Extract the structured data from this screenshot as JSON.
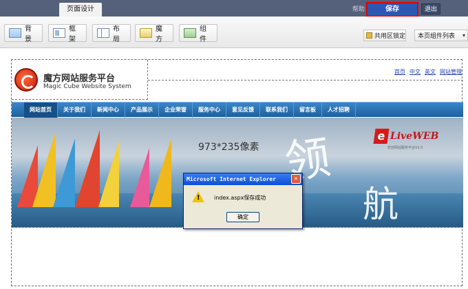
{
  "topbar": {
    "tab": "页面设计",
    "help": "帮助",
    "save": "保存",
    "logout": "退出"
  },
  "toolbar": {
    "buttons": [
      {
        "label": "背景",
        "icon": "background-icon"
      },
      {
        "label": "框架",
        "icon": "frame-icon"
      },
      {
        "label": "布局",
        "icon": "layout-icon"
      },
      {
        "label": "魔方",
        "icon": "magic-cube-icon"
      },
      {
        "label": "组件",
        "icon": "component-icon"
      }
    ],
    "lock_area": "共用区锁定",
    "component_list": "本页组件列表"
  },
  "site": {
    "logo_cn": "魔方网站服务平台",
    "logo_en": "Magic Cube Website System",
    "top_links": [
      "首页",
      "中文",
      "英文",
      "网站管理"
    ],
    "nav": [
      "网站首页",
      "关于我们",
      "新闻中心",
      "产品展示",
      "企业荣誉",
      "服务中心",
      "意见反馈",
      "联系我们",
      "留言板",
      "人才招聘"
    ],
    "banner_size": "973*235像素",
    "brand": "LiveWEB",
    "brand_sub": "宏创网站服务平台V2.0",
    "calligraphy_1": "领",
    "calligraphy_2": "航"
  },
  "dialog": {
    "title": "Microsoft Internet Explorer",
    "message": "index.aspx保存成功",
    "ok": "确定"
  },
  "colors": {
    "topbar": "#55607a",
    "save_highlight": "#e60000",
    "nav": "#2a72b5"
  }
}
